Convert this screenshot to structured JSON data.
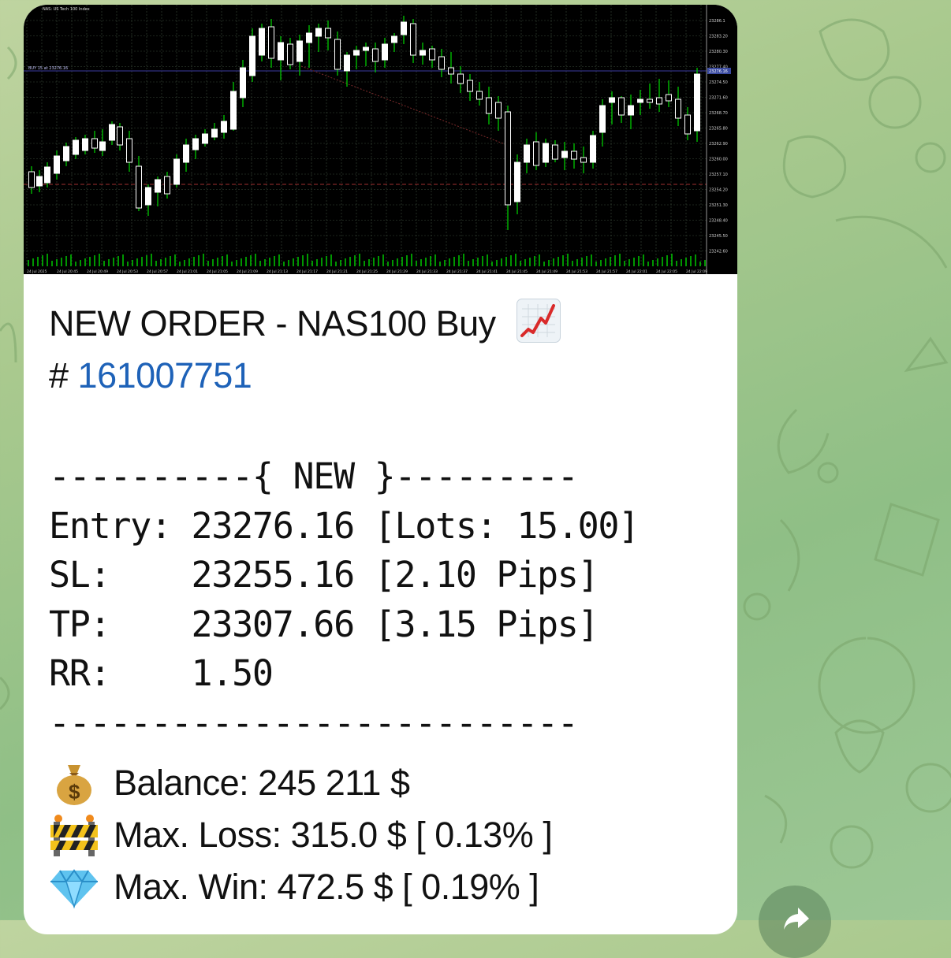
{
  "chart": {
    "symbol_label": "NAS: US Tech 100 Index",
    "order_label": "BUY 15 at 23276.16",
    "price_scale": [
      "23286.1",
      "23283.20",
      "23280.30",
      "23277.40",
      "23274.50",
      "23271.60",
      "23268.70",
      "23265.80",
      "23262.90",
      "23260.00",
      "23257.10",
      "23254.20",
      "23251.30",
      "23248.40",
      "23245.50",
      "23242.60"
    ],
    "current_price": "23276.16",
    "time_labels": [
      "24 Jul 2025",
      "24 Jul 20:45",
      "24 Jul 20:49",
      "24 Jul 20:53",
      "24 Jul 20:57",
      "24 Jul 21:01",
      "24 Jul 21:05",
      "24 Jul 21:09",
      "24 Jul 21:13",
      "24 Jul 21:17",
      "24 Jul 21:21",
      "24 Jul 21:25",
      "24 Jul 21:29",
      "24 Jul 21:33",
      "24 Jul 21:37",
      "24 Jul 21:41",
      "24 Jul 21:45",
      "24 Jul 21:49",
      "24 Jul 21:53",
      "24 Jul 21:57",
      "24 Jul 22:01",
      "24 Jul 22:05",
      "24 Jul 22:09"
    ],
    "colors": {
      "background": "#000000",
      "bull_candle": "#ffffff",
      "bear_candle": "#ffffff",
      "wick": "#00c800",
      "grid": "#3a4a3a",
      "entry_line": "#3a3aa0",
      "sl_line": "#a03030"
    }
  },
  "message": {
    "title": "NEW ORDER - NAS100 Buy",
    "title_icon": "chart-increasing-icon",
    "hash_symbol": "#",
    "order_id": "161007751",
    "mono_lines": [
      "----------{ NEW }---------",
      "Entry: 23276.16 [Lots: 15.00]",
      "SL:    23255.16 [2.10 Pips]",
      "TP:    23307.66 [3.15 Pips]",
      "RR:    1.50",
      "--------------------------"
    ],
    "balance": "Balance: 245 211 $",
    "max_loss": "Max. Loss: 315.0 $ [ 0.13% ]",
    "max_win": "Max. Win: 472.5 $ [ 0.19% ]",
    "icons": {
      "balance": "money-bag-icon",
      "loss": "construction-icon",
      "win": "gem-icon"
    }
  },
  "controls": {
    "share": "share-arrow-icon"
  }
}
